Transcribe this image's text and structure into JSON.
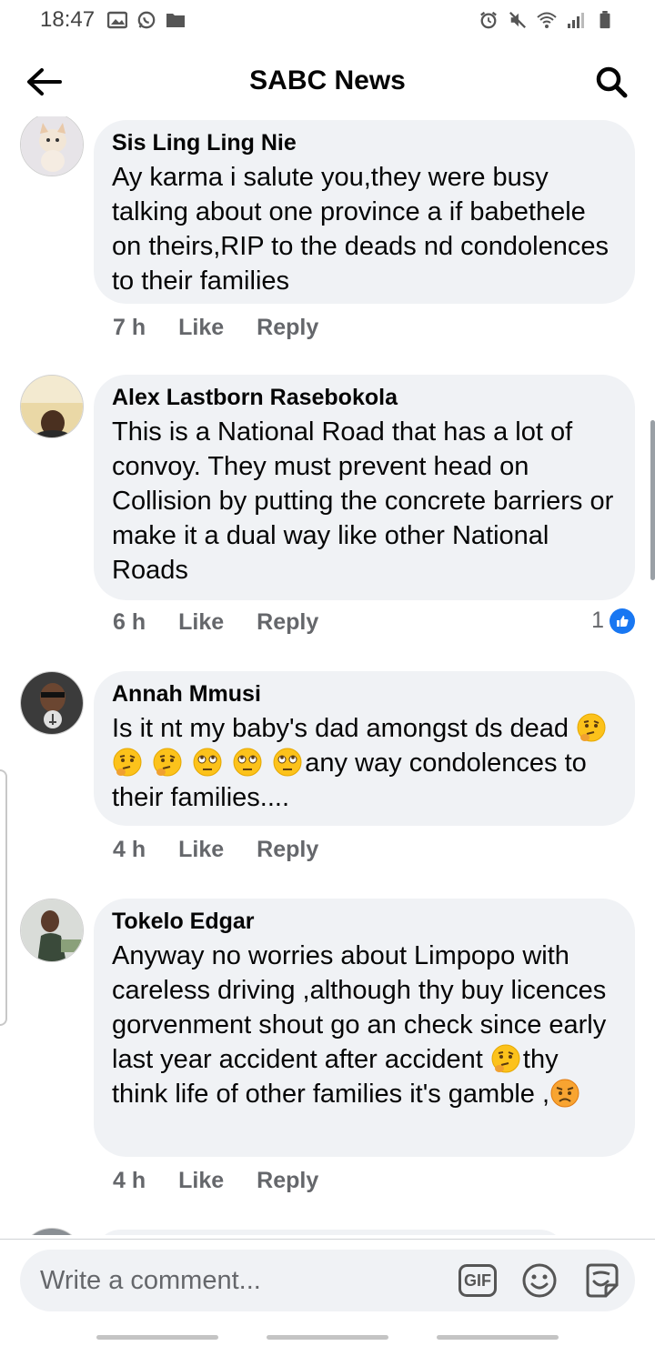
{
  "status_bar": {
    "time": "18:47"
  },
  "header": {
    "title": "SABC News"
  },
  "comments": [
    {
      "author": "Sis Ling Ling Nie",
      "text": "Ay karma i salute you,they were busy talking about one province a if babethele on theirs,RIP to the deads nd condolences to their families",
      "time": "7 h",
      "like_label": "Like",
      "reply_label": "Reply",
      "reaction_count": ""
    },
    {
      "author": "Alex Lastborn Rasebokola",
      "text": "This is a National Road that has a lot of convoy. They must prevent head on Collision by putting the concrete barriers or make it a dual way like other National Roads",
      "time": "6 h",
      "like_label": "Like",
      "reply_label": "Reply",
      "reaction_count": "1"
    },
    {
      "author": "Annah Mmusi",
      "text_before": "Is it nt my baby's dad amongst ds dead",
      "text_after": "any way condolences to their families....",
      "time": "4 h",
      "like_label": "Like",
      "reply_label": "Reply"
    },
    {
      "author": "Tokelo Edgar",
      "text_before": "Anyway no worries about Limpopo with careless driving ,although thy buy licences gorvenment shout go an check since early last year accident after accident ",
      "text_middle": "thy think life of other families it's gamble ,",
      "time": "4 h",
      "like_label": "Like",
      "reply_label": "Reply"
    }
  ],
  "composer": {
    "placeholder": "Write a comment...",
    "gif_label": "GIF"
  },
  "colors": {
    "bubble": "#f0f2f5",
    "meta": "#65676b",
    "like_blue": "#1877f2"
  }
}
